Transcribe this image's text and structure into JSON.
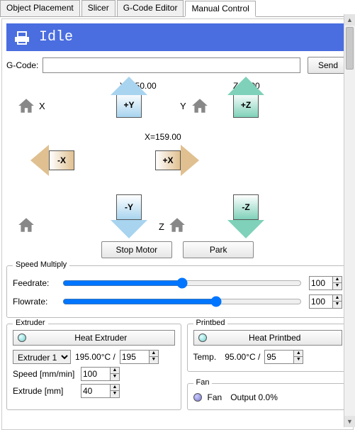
{
  "tabs": [
    "Object Placement",
    "Slicer",
    "G-Code Editor",
    "Manual Control"
  ],
  "active_tab": 3,
  "status": "Idle",
  "gcode": {
    "label": "G-Code:",
    "value": "",
    "send": "Send"
  },
  "positions": {
    "x_label": "X=159.00",
    "y_label": "Y=150.00",
    "z_label": "Z=0.00"
  },
  "axes": {
    "x": "X",
    "y": "Y",
    "z": "Z"
  },
  "move": {
    "py": "+Y",
    "ny": "-Y",
    "px": "+X",
    "nx": "-X",
    "pz": "+Z",
    "nz": "-Z"
  },
  "cmds": {
    "stop": "Stop Motor",
    "park": "Park"
  },
  "speed": {
    "title": "Speed Multiply",
    "feedrate": {
      "label": "Feedrate:",
      "value": "100"
    },
    "flowrate": {
      "label": "Flowrate:",
      "value": "100"
    }
  },
  "extruder": {
    "title": "Extruder",
    "heat": "Heat Extruder",
    "selector": "Extruder 1",
    "temp": "195.00°C /",
    "target": "195",
    "speed_label": "Speed [mm/min]",
    "speed_value": "100",
    "extrude_label": "Extrude [mm]",
    "extrude_value": "40"
  },
  "printbed": {
    "title": "Printbed",
    "heat": "Heat Printbed",
    "temp_label": "Temp.",
    "temp": "95.00°C /",
    "target": "95"
  },
  "fan": {
    "title": "Fan",
    "label": "Fan",
    "output": "Output 0.0%"
  }
}
